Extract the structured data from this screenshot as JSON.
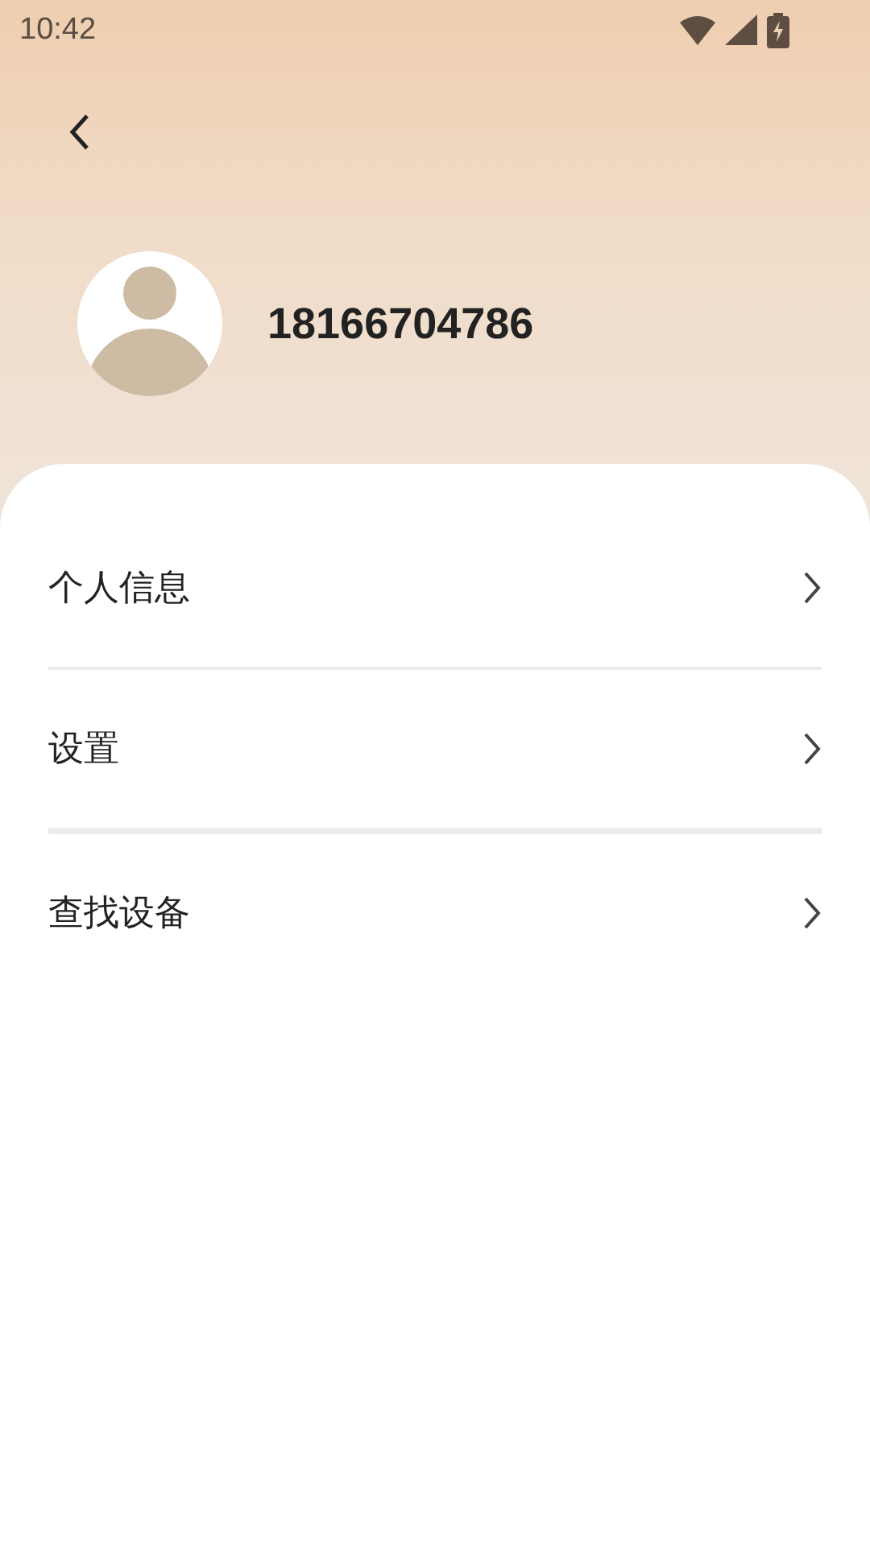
{
  "status_bar": {
    "time": "10:42"
  },
  "profile": {
    "phone": "18166704786"
  },
  "menu": [
    {
      "label": "个人信息"
    },
    {
      "label": "设置"
    },
    {
      "label": "查找设备"
    }
  ]
}
